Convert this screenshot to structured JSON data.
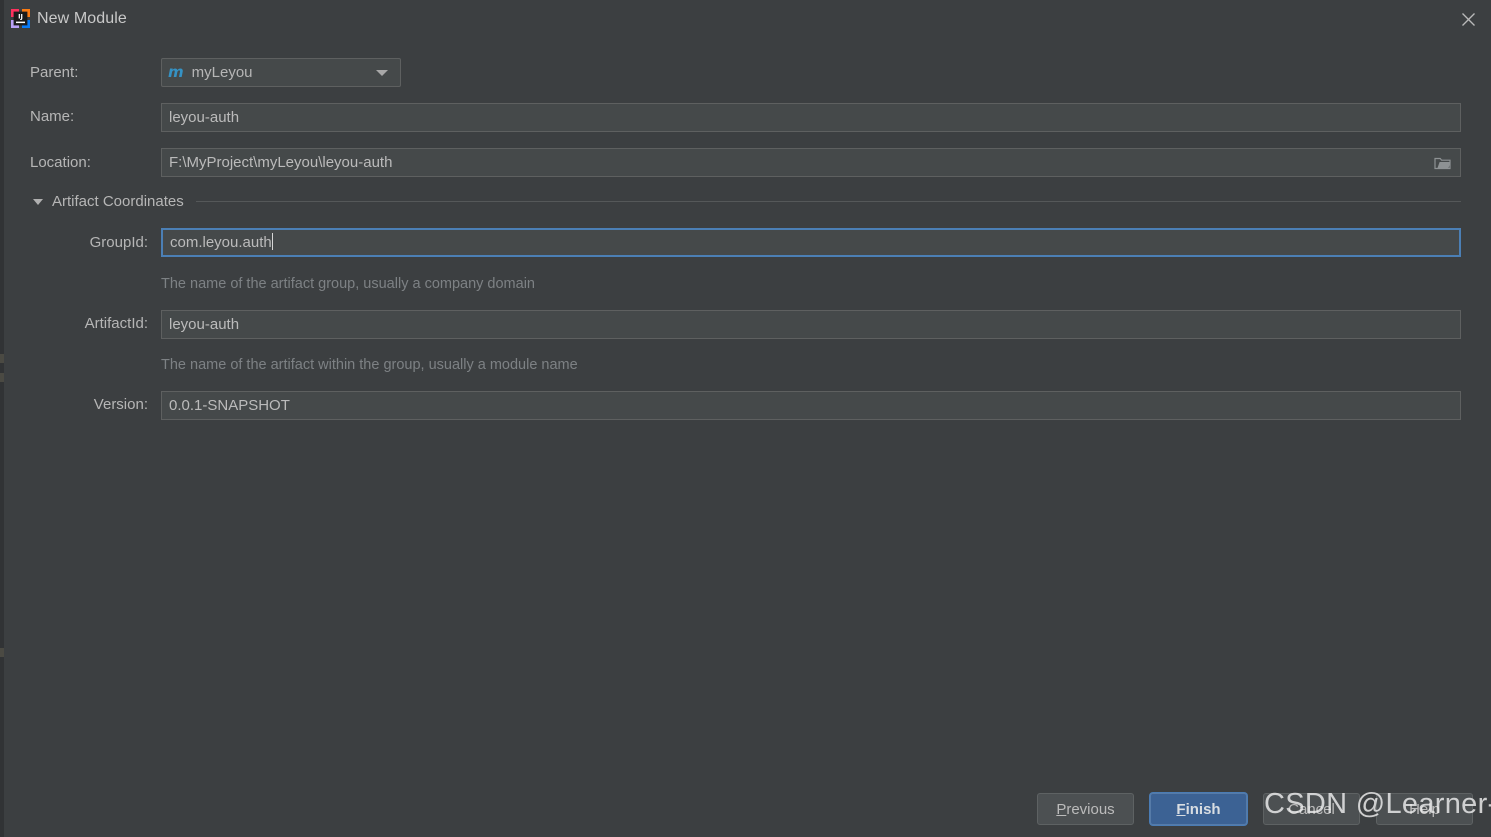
{
  "window": {
    "title": "New Module",
    "app_icon": "intellij-idea-icon",
    "close_icon": "close-icon",
    "background_color": "#3c3f41"
  },
  "form": {
    "parent": {
      "label": "Parent:",
      "value": "myLeyou",
      "module_icon_glyph": "m",
      "module_icon_color": "#3592c4",
      "dropdown_icon": "chevron-down-icon"
    },
    "name": {
      "label": "Name:",
      "value": "leyou-auth"
    },
    "location": {
      "label": "Location:",
      "value": "F:\\MyProject\\myLeyou\\leyou-auth",
      "browse_icon": "folder-icon"
    }
  },
  "artifact_section": {
    "title": "Artifact Coordinates",
    "expanded": true,
    "toggle_icon": "triangle-down-icon",
    "group_id": {
      "label": "GroupId:",
      "value": "com.leyou.auth",
      "helper": "The name of the artifact group, usually a company domain",
      "focused": true,
      "focus_color": "#4b7fb5"
    },
    "artifact_id": {
      "label": "ArtifactId:",
      "value": "leyou-auth",
      "helper": "The name of the artifact within the group, usually a module name"
    },
    "version": {
      "label": "Version:",
      "value": "0.0.1-SNAPSHOT"
    }
  },
  "buttons": {
    "previous": {
      "label_mnemonic": "P",
      "label_rest": "revious"
    },
    "finish": {
      "label_mnemonic": "F",
      "label_rest": "inish",
      "primary": true,
      "color": "#3c6294"
    },
    "cancel": {
      "label": "Cancel"
    },
    "help": {
      "label": "Help"
    }
  },
  "watermark": {
    "text": "CSDN @Learner-Wang"
  }
}
